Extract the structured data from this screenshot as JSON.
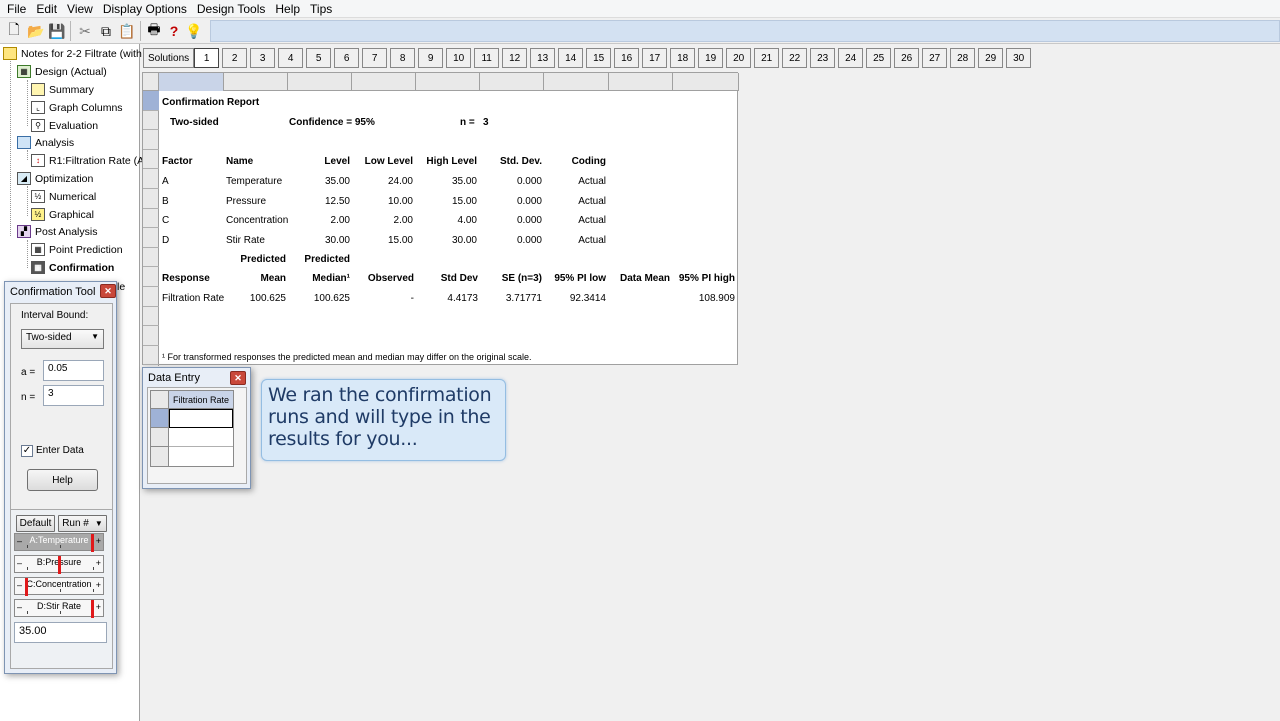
{
  "menu": [
    "File",
    "Edit",
    "View",
    "Display Options",
    "Design Tools",
    "Help",
    "Tips"
  ],
  "toolbar": {
    "icons": [
      "new-file-icon",
      "open-folder-icon",
      "save-icon",
      "cut-icon",
      "copy-icon",
      "paste-icon",
      "print-icon",
      "help-question-icon",
      "tip-lightbulb-icon"
    ],
    "glyphs": [
      "🗋",
      "📂",
      "💾",
      "✂",
      "⧉",
      "📋",
      "🖶",
      "?",
      "💡"
    ]
  },
  "tree": {
    "root": "Notes for 2-2 Filtrate (with",
    "design": "Design (Actual)",
    "summary": "Summary",
    "graph_columns": "Graph Columns",
    "evaluation": "Evaluation",
    "analysis": "Analysis",
    "r1": "R1:Filtration Rate (A",
    "optimization": "Optimization",
    "numerical": "Numerical",
    "graphical": "Graphical",
    "post_analysis": "Post Analysis",
    "point_prediction": "Point Prediction",
    "confirmation": "Confirmation",
    "hidden_suffix": "le"
  },
  "solutions": {
    "label": "Solutions",
    "tabs": [
      "1",
      "2",
      "3",
      "4",
      "5",
      "6",
      "7",
      "8",
      "9",
      "10",
      "11",
      "12",
      "13",
      "14",
      "15",
      "16",
      "17",
      "18",
      "19",
      "20",
      "21",
      "22",
      "23",
      "24",
      "25",
      "26",
      "27",
      "28",
      "29",
      "30"
    ],
    "active": "1"
  },
  "report": {
    "title": "Confirmation Report",
    "sided": "Two-sided",
    "confidence": "Confidence = 95%",
    "n_label": "n =",
    "n_value": "3",
    "factor_headers": [
      "Factor",
      "Name",
      "Level",
      "Low Level",
      "High Level",
      "Std. Dev.",
      "Coding"
    ],
    "factors": [
      [
        "A",
        "Temperature",
        "35.00",
        "24.00",
        "35.00",
        "0.000",
        "Actual"
      ],
      [
        "B",
        "Pressure",
        "12.50",
        "10.00",
        "15.00",
        "0.000",
        "Actual"
      ],
      [
        "C",
        "Concentration",
        "2.00",
        "2.00",
        "4.00",
        "0.000",
        "Actual"
      ],
      [
        "D",
        "Stir Rate",
        "30.00",
        "15.00",
        "30.00",
        "0.000",
        "Actual"
      ]
    ],
    "predicted_1": "Predicted",
    "predicted_2": "Predicted",
    "response_headers": [
      "Response",
      "Mean",
      "Median¹",
      "Observed",
      "Std Dev",
      "SE (n=3)",
      "95% PI low",
      "Data Mean",
      "95% PI high"
    ],
    "response_row": [
      "Filtration Rate",
      "100.625",
      "100.625",
      "-",
      "4.4173",
      "3.71771",
      "92.3414",
      "",
      "108.909"
    ],
    "footnote": "¹ For transformed responses the predicted mean and median may differ on the original scale."
  },
  "confirmation_tool": {
    "title": "Confirmation Tool",
    "interval_bound_label": "Interval Bound:",
    "interval_bound_value": "Two-sided",
    "alpha_label": "a =",
    "alpha_value": "0.05",
    "n_label": "n =",
    "n_value": "3",
    "enter_data_label": "Enter Data",
    "enter_data_checked": true,
    "help_label": "Help"
  },
  "factors_panel": {
    "default_label": "Default",
    "run_label": "Run #",
    "sliders": [
      {
        "label": "A:Temperature",
        "level": 1.0
      },
      {
        "label": "B:Pressure",
        "level": 0.5
      },
      {
        "label": "C:Concentration",
        "level": 0.0
      },
      {
        "label": "D:Stir Rate",
        "level": 1.0
      }
    ],
    "value": "35.00"
  },
  "data_entry": {
    "title": "Data Entry",
    "column": "Filtration Rate",
    "rows": [
      "",
      "",
      ""
    ]
  },
  "callout": {
    "text": "We ran the confirmation runs and will type in the results for you..."
  },
  "colors": {
    "accent": "#d3e1f2",
    "marker": "#e0191b",
    "callout_bg": "#d9e9f8",
    "callout_text": "#1f3b66"
  }
}
